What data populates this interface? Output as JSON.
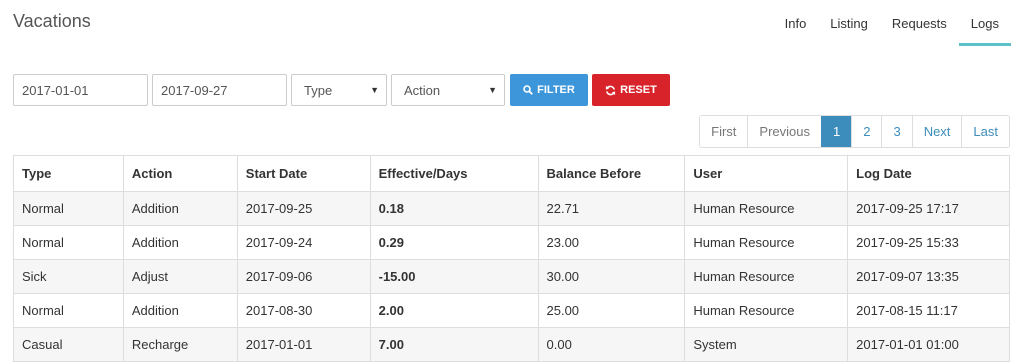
{
  "header": {
    "title": "Vacations",
    "tabs": [
      {
        "label": "Info",
        "active": false
      },
      {
        "label": "Listing",
        "active": false
      },
      {
        "label": "Requests",
        "active": false
      },
      {
        "label": "Logs",
        "active": true
      }
    ]
  },
  "filters": {
    "date_from": "2017-01-01",
    "date_to": "2017-09-27",
    "type_select": "Type",
    "action_select": "Action",
    "filter_button": "FILTER",
    "reset_button": "RESET"
  },
  "pagination": {
    "first": "First",
    "previous": "Previous",
    "pages": [
      "1",
      "2",
      "3"
    ],
    "current_page": "1",
    "next": "Next",
    "last": "Last"
  },
  "table": {
    "headers": [
      "Type",
      "Action",
      "Start Date",
      "Effective/Days",
      "Balance Before",
      "User",
      "Log Date"
    ],
    "rows": [
      [
        "Normal",
        "Addition",
        "2017-09-25",
        "0.18",
        "22.71",
        "Human Resource",
        "2017-09-25 17:17"
      ],
      [
        "Normal",
        "Addition",
        "2017-09-24",
        "0.29",
        "23.00",
        "Human Resource",
        "2017-09-25 15:33"
      ],
      [
        "Sick",
        "Adjust",
        "2017-09-06",
        "-15.00",
        "30.00",
        "Human Resource",
        "2017-09-07 13:35"
      ],
      [
        "Normal",
        "Addition",
        "2017-08-30",
        "2.00",
        "25.00",
        "Human Resource",
        "2017-08-15 11:17"
      ],
      [
        "Casual",
        "Recharge",
        "2017-01-01",
        "7.00",
        "0.00",
        "System",
        "2017-01-01 01:00"
      ]
    ]
  },
  "colors": {
    "filter_button": "#3c96d9",
    "reset_button": "#d9232a",
    "active_page": "#3c8dbc",
    "active_tab_underline": "#5bc0c7"
  },
  "icons": {
    "filter": "search-icon",
    "reset": "refresh-icon",
    "select_caret": "caret-down-icon"
  }
}
